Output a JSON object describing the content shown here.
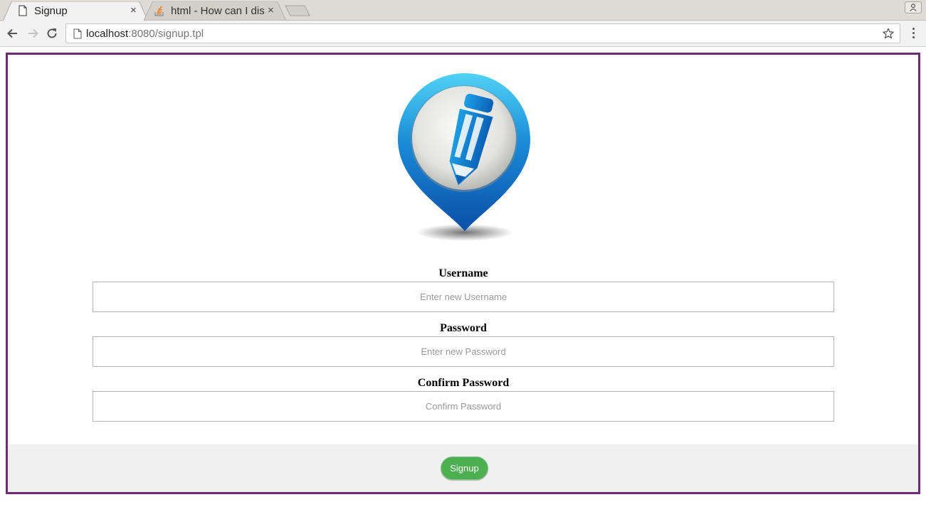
{
  "browser": {
    "tabs": [
      {
        "title": "Signup",
        "close": "×"
      },
      {
        "title": "html - How can I dis",
        "close": "×"
      }
    ],
    "url_host": "localhost",
    "url_rest": ":8080/signup.tpl"
  },
  "form": {
    "username": {
      "label": "Username",
      "placeholder": "Enter new Username"
    },
    "password": {
      "label": "Password",
      "placeholder": "Enter new Password"
    },
    "confirm": {
      "label": "Confirm Password",
      "placeholder": "Confirm Password"
    }
  },
  "footer": {
    "signup_label": "Signup"
  },
  "colors": {
    "frame_border": "#6b2c74",
    "signup_button": "#4caf50",
    "footer_bg": "#f1f0f0",
    "logo_blue": "#1e7fd0"
  },
  "icons": {
    "logo": "map-pin-pencil-icon",
    "back": "arrow-left-icon",
    "forward": "arrow-right-icon",
    "reload": "reload-icon",
    "bookmark": "star-icon",
    "menu": "kebab-menu-icon"
  }
}
